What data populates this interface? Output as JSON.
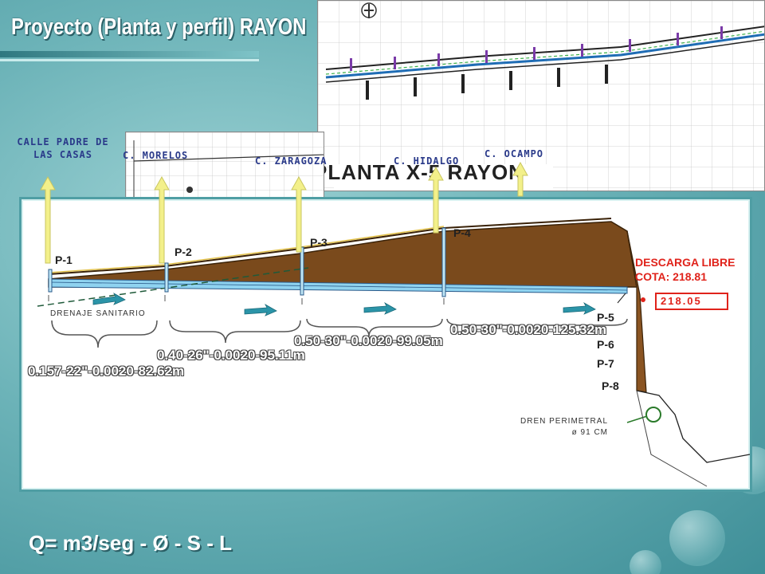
{
  "slide": {
    "title": "Proyecto (Planta y perfil)  RAYON",
    "formula": "Q= m3/seg - Ø - S - L"
  },
  "plan": {
    "label": "PLANTA  X-5 RAYON"
  },
  "streets": [
    {
      "name": "CALLE PADRE DE LAS CASAS",
      "line1": "CALLE PADRE DE",
      "line2": "LAS CASAS"
    },
    {
      "name": "C. MORELOS"
    },
    {
      "name": "C. ZARAGOZA"
    },
    {
      "name": "C. HIDALGO"
    },
    {
      "name": "C. OCAMPO"
    }
  ],
  "profile": {
    "wells": [
      "P-1",
      "P-2",
      "P-3",
      "P-4",
      "P-5",
      "P-6",
      "P-7",
      "P-8"
    ],
    "segments": [
      {
        "label": "0.157-22\"-0.0020-82.62m"
      },
      {
        "label": "0.40-26\"-0.0020-95.11m"
      },
      {
        "label": "0.50-30\"-0.0020-99.05m"
      },
      {
        "label": "0.50-30\"-0.0020-125.32m"
      }
    ],
    "discharge_line1": "DESCARGA LIBRE",
    "discharge_line2": "COTA: 218.81",
    "elevation": "218.05",
    "drain_sanitary": "DRENAJE SANITARIO",
    "drain_perimeter_line1": "DREN PERIMETRAL",
    "drain_perimeter_line2": "ø 91 CM"
  },
  "colors": {
    "soil": "#7a4a1c",
    "pipe": "#8fd3f0",
    "accent": "#e0231b",
    "background": "#6cb3b8"
  }
}
